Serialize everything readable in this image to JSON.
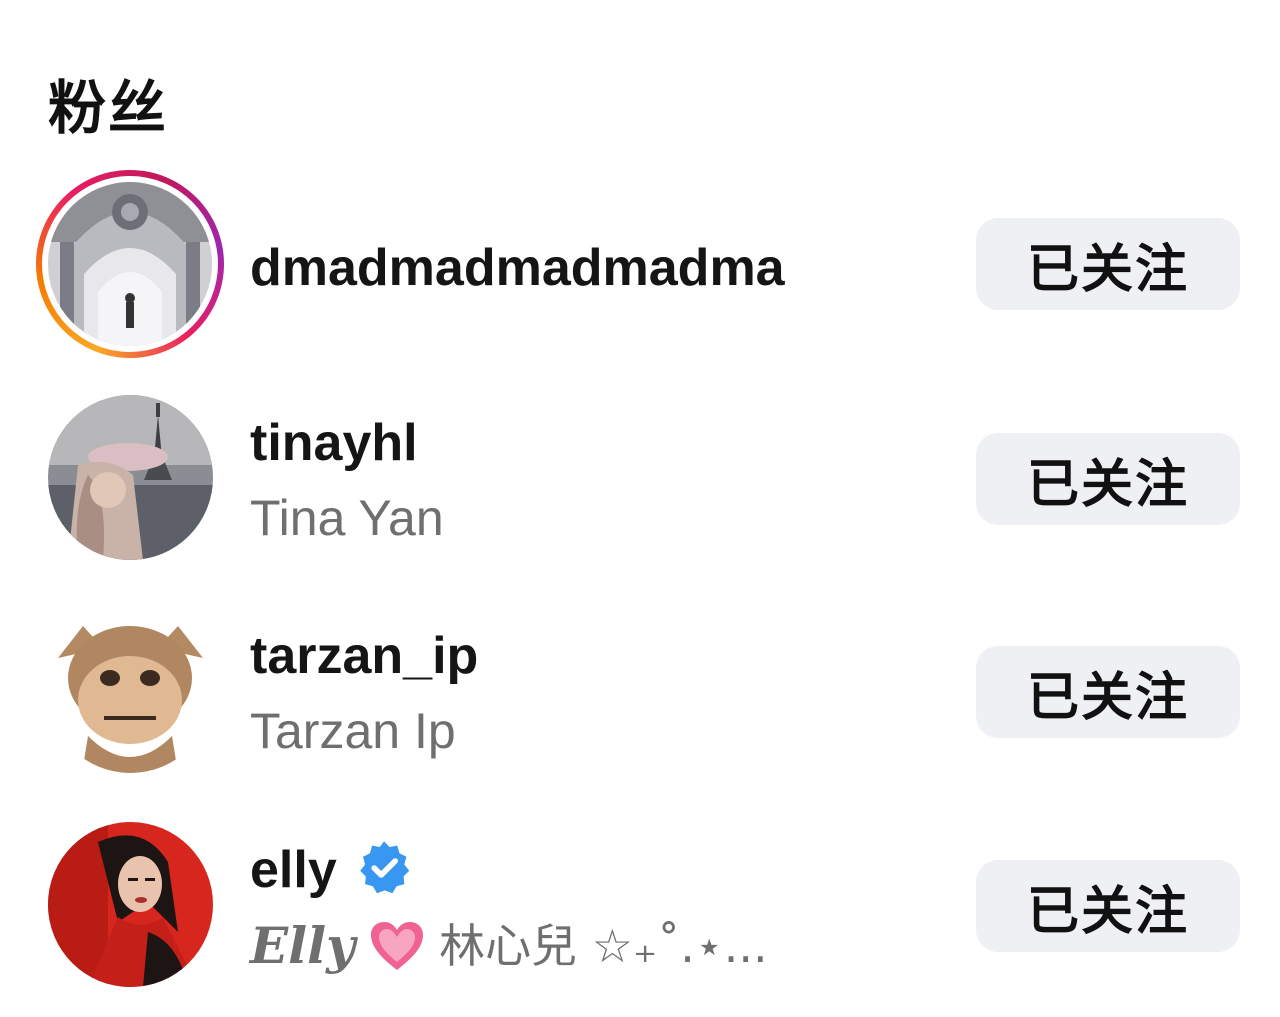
{
  "header": {
    "title": "粉丝"
  },
  "followers": [
    {
      "username": "dmadmadmadmadma",
      "full_name": "",
      "button_label": "已关注",
      "has_story": true,
      "verified": false,
      "avatar_icon": "cathedral-photo-avatar"
    },
    {
      "username": "tinayhl",
      "full_name": "Tina Yan",
      "button_label": "已关注",
      "has_story": false,
      "verified": false,
      "avatar_icon": "paris-photo-avatar"
    },
    {
      "username": "tarzan_ip",
      "full_name": "Tarzan Ip",
      "button_label": "已关注",
      "has_story": false,
      "verified": false,
      "avatar_icon": "monkey-avatar"
    },
    {
      "username": "elly",
      "full_name": "Elly",
      "full_name_rest": "林心兒 ☆₊˚.⋆...",
      "button_label": "已关注",
      "has_story": false,
      "verified": true,
      "avatar_icon": "woman-red-photo-avatar"
    }
  ],
  "colors": {
    "button_bg": "#eff0f3",
    "verified_blue": "#3897f0",
    "secondary_text": "#6f6f6f",
    "heart_pink": "#f06292"
  }
}
